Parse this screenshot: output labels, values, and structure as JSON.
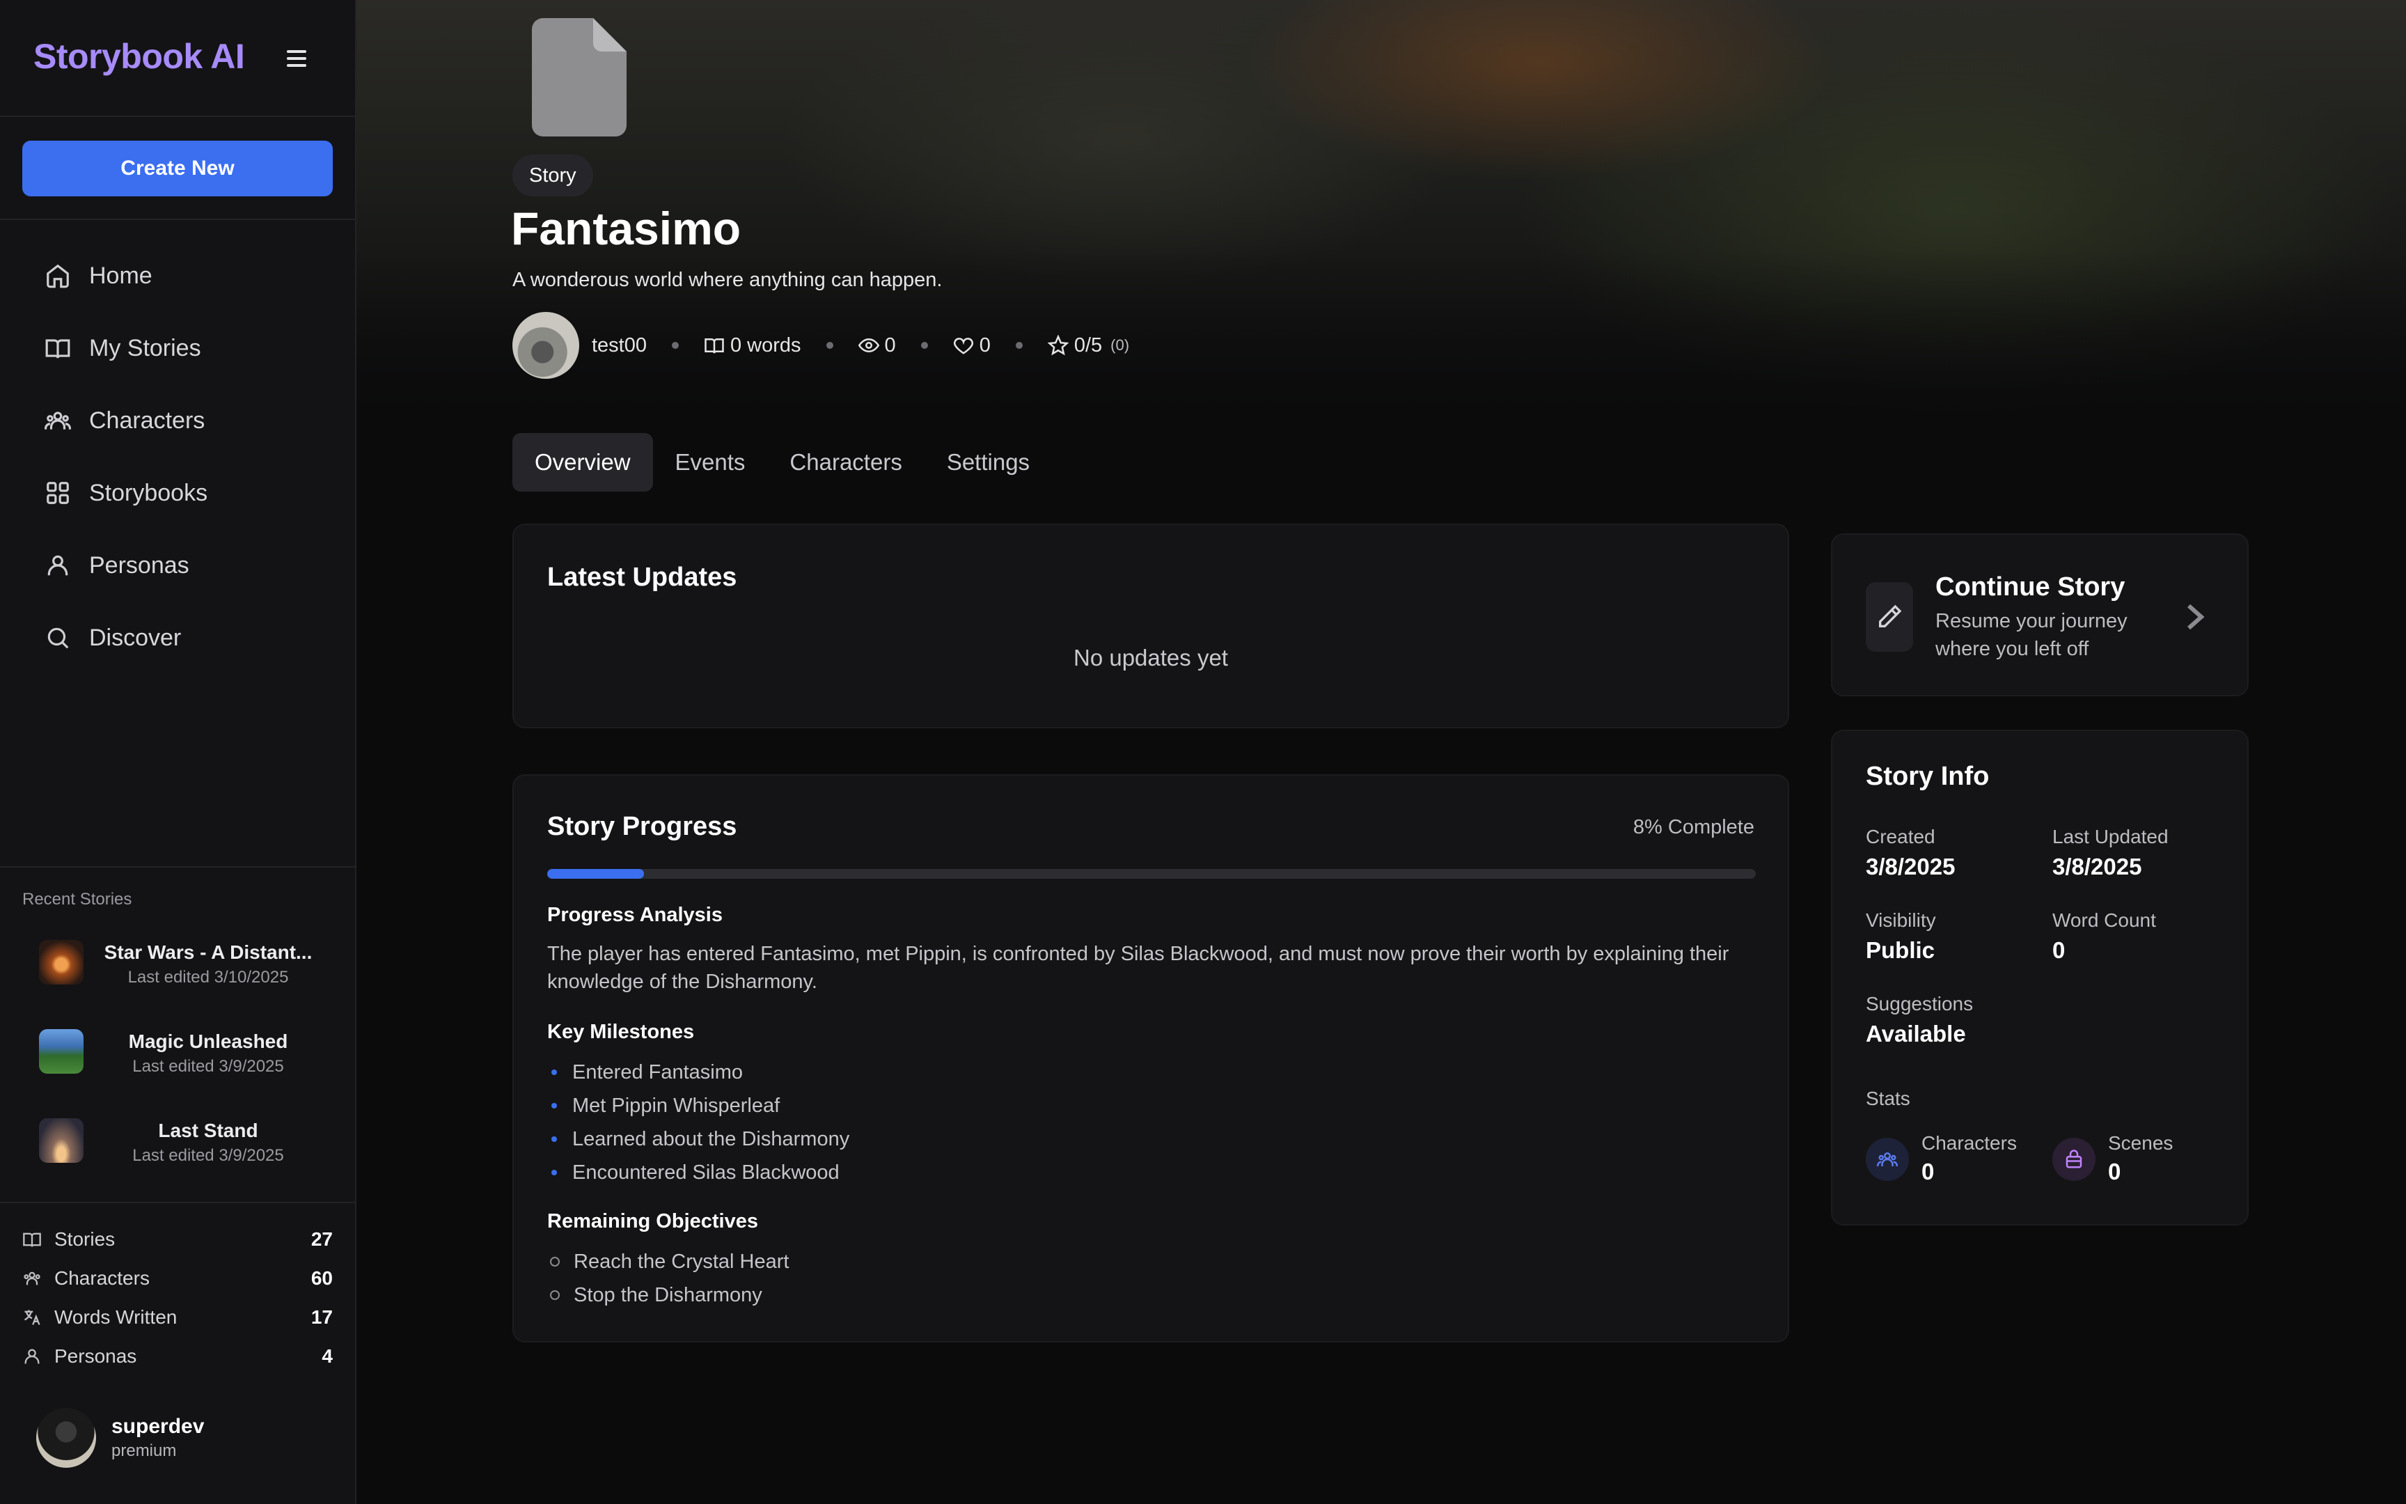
{
  "app": {
    "brand": "Storybook AI",
    "create_label": "Create New"
  },
  "nav": [
    {
      "label": "Home",
      "icon": "home-icon"
    },
    {
      "label": "My Stories",
      "icon": "book-icon"
    },
    {
      "label": "Characters",
      "icon": "users-icon"
    },
    {
      "label": "Storybooks",
      "icon": "grid-icon"
    },
    {
      "label": "Personas",
      "icon": "user-icon"
    },
    {
      "label": "Discover",
      "icon": "search-icon"
    }
  ],
  "recent": {
    "title": "Recent Stories",
    "items": [
      {
        "name": "Star Wars - A Distant...",
        "date": "Last edited 3/10/2025"
      },
      {
        "name": "Magic Unleashed",
        "date": "Last edited 3/9/2025"
      },
      {
        "name": "Last Stand",
        "date": "Last edited 3/9/2025"
      }
    ]
  },
  "stats": [
    {
      "label": "Stories",
      "value": "27",
      "icon": "book-icon"
    },
    {
      "label": "Characters",
      "value": "60",
      "icon": "users-icon"
    },
    {
      "label": "Words Written",
      "value": "17",
      "icon": "translate-icon"
    },
    {
      "label": "Personas",
      "value": "4",
      "icon": "user-icon"
    }
  ],
  "user": {
    "name": "superdev",
    "plan": "premium"
  },
  "story": {
    "badge": "Story",
    "title": "Fantasimo",
    "description": "A wonderous world where anything can happen.",
    "author": "test00",
    "words": "0 words",
    "views": "0",
    "likes": "0",
    "rating": "0/5",
    "rating_count": "(0)"
  },
  "tabs": [
    {
      "label": "Overview",
      "active": true
    },
    {
      "label": "Events",
      "active": false
    },
    {
      "label": "Characters",
      "active": false
    },
    {
      "label": "Settings",
      "active": false
    }
  ],
  "updates": {
    "title": "Latest Updates",
    "empty": "No updates yet"
  },
  "progress": {
    "title": "Story Progress",
    "percent_label": "8% Complete",
    "percent": 8,
    "analysis_title": "Progress Analysis",
    "analysis": "The player has entered Fantasimo, met Pippin, is confronted by Silas Blackwood, and must now prove their worth by explaining their knowledge of the Disharmony.",
    "milestones_title": "Key Milestones",
    "milestones": [
      "Entered Fantasimo",
      "Met Pippin Whisperleaf",
      "Learned about the Disharmony",
      "Encountered Silas Blackwood"
    ],
    "objectives_title": "Remaining Objectives",
    "objectives": [
      "Reach the Crystal Heart",
      "Stop the Disharmony"
    ]
  },
  "continue": {
    "title": "Continue Story",
    "subtitle": "Resume your journey where you left off"
  },
  "info": {
    "title": "Story Info",
    "created_label": "Created",
    "created": "3/8/2025",
    "updated_label": "Last Updated",
    "updated": "3/8/2025",
    "visibility_label": "Visibility",
    "visibility": "Public",
    "wordcount_label": "Word Count",
    "wordcount": "0",
    "suggestions_label": "Suggestions",
    "suggestions": "Available",
    "stats_label": "Stats",
    "characters_label": "Characters",
    "characters": "0",
    "scenes_label": "Scenes",
    "scenes": "0"
  },
  "colors": {
    "accent": "#3b6ff0",
    "brand": "#a78bfa",
    "scenes": "#c084fc"
  }
}
